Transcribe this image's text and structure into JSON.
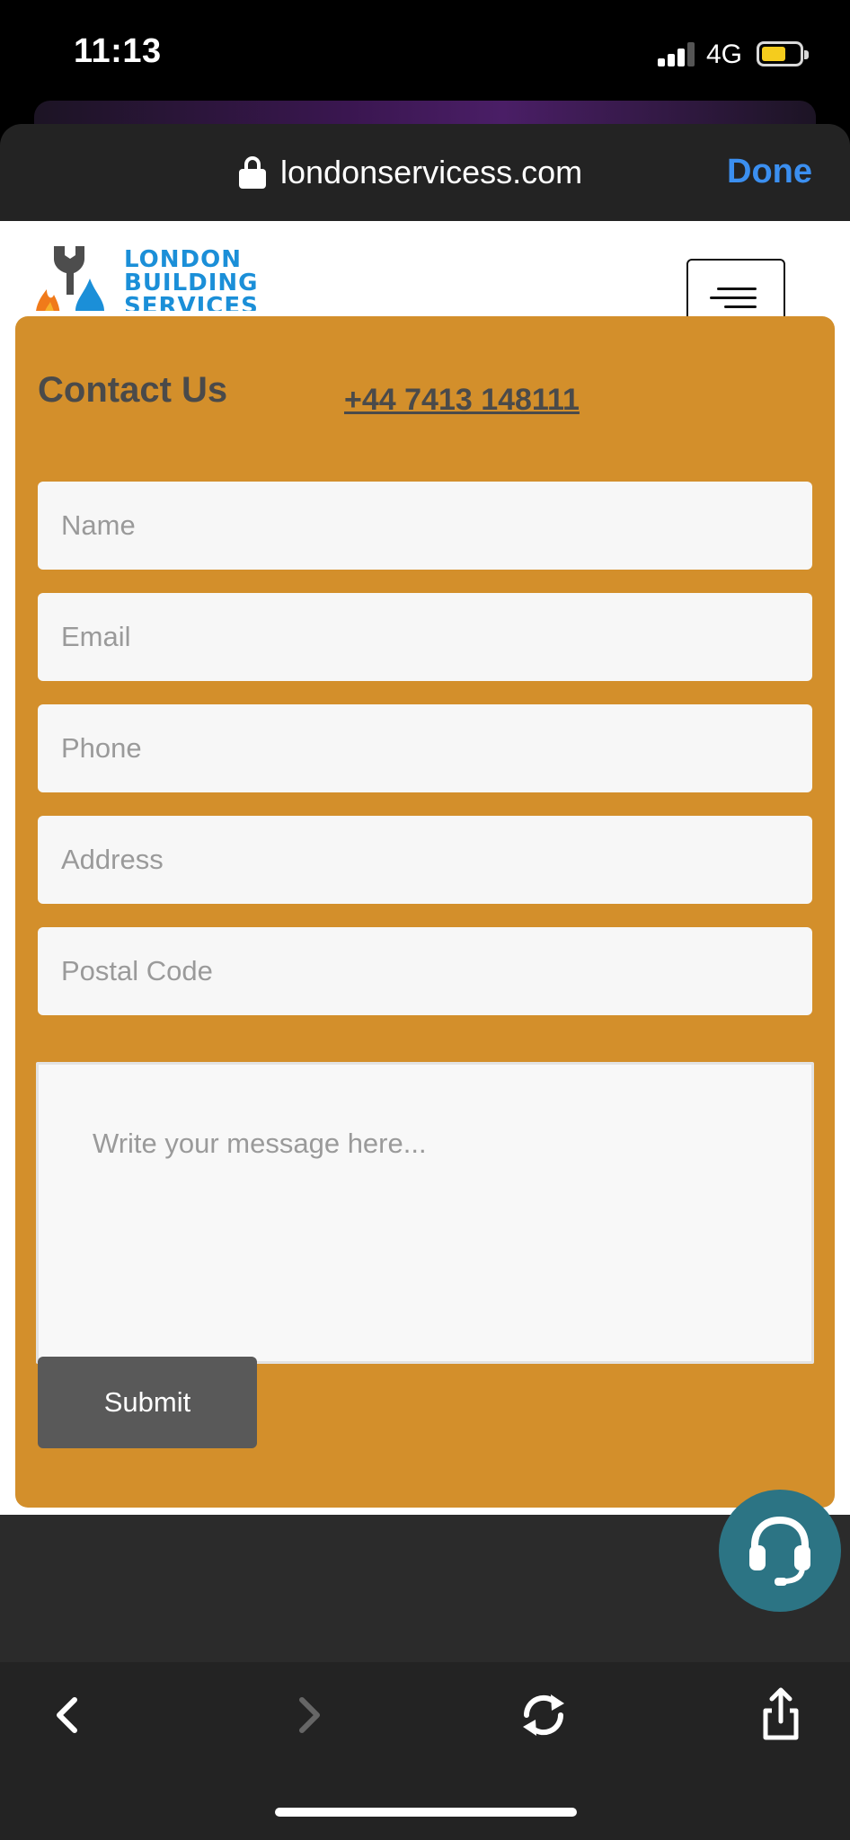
{
  "status_bar": {
    "time": "11:13",
    "network": "4G",
    "battery_color": "#f5cc1d"
  },
  "browser": {
    "url": "londonservicess.com",
    "done_label": "Done",
    "accent_color": "#3b8ff0"
  },
  "site": {
    "logo": {
      "line1": "LONDON",
      "line2": "BUILDING",
      "line3": "SERVICES"
    },
    "menu_icon": "hamburger-icon"
  },
  "contact": {
    "title": "Contact Us",
    "phone": "+44 7413 148111",
    "panel_color": "#d38f2b",
    "fields": {
      "name_placeholder": "Name",
      "email_placeholder": "Email",
      "phone_placeholder": "Phone",
      "address_placeholder": "Address",
      "postal_placeholder": "Postal Code",
      "message_placeholder": "Write your message here..."
    },
    "submit_label": "Submit"
  },
  "support_fab": {
    "icon": "headset-icon",
    "color": "#2c7484"
  },
  "toolbar": {
    "icons": [
      "back-icon",
      "forward-icon",
      "reload-icon",
      "share-icon"
    ]
  }
}
